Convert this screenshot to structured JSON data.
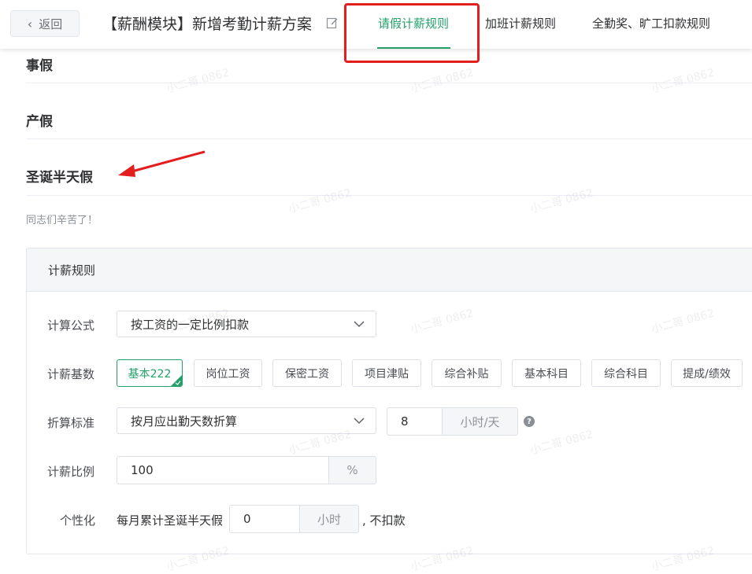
{
  "header": {
    "back_label": "返回",
    "page_title": "【薪酬模块】新增考勤计薪方案",
    "tabs": [
      "请假计薪规则",
      "加班计薪规则",
      "全勤奖、旷工扣款规则"
    ],
    "active_tab_color": "#23a06a",
    "highlight_color": "#e31e1e"
  },
  "sections": {
    "personal_leave": "事假",
    "maternity_leave": "产假",
    "christmas_half_day": "圣诞半天假",
    "note": "同志们辛苦了！"
  },
  "rules_card": {
    "title": "计薪规则",
    "formula": {
      "label": "计算公式",
      "value": "按工资的一定比例扣款"
    },
    "base": {
      "label": "计薪基数",
      "items": [
        "基本222",
        "岗位工资",
        "保密工资",
        "项目津贴",
        "综合补贴",
        "基本科目",
        "综合科目",
        "提成/绩效"
      ],
      "selected": "基本222"
    },
    "conversion": {
      "label": "折算标准",
      "value": "按月应出勤天数折算",
      "hours": "8",
      "hours_unit": "小时/天",
      "help_glyph": "?"
    },
    "ratio": {
      "label": "计薪比例",
      "value": "100",
      "unit": "%"
    },
    "personalize": {
      "label": "个性化",
      "prefix": "每月累计圣诞半天假",
      "value": "0",
      "unit": "小时",
      "suffix": ", 不扣款"
    }
  },
  "watermark_text": "小二哥 0862"
}
